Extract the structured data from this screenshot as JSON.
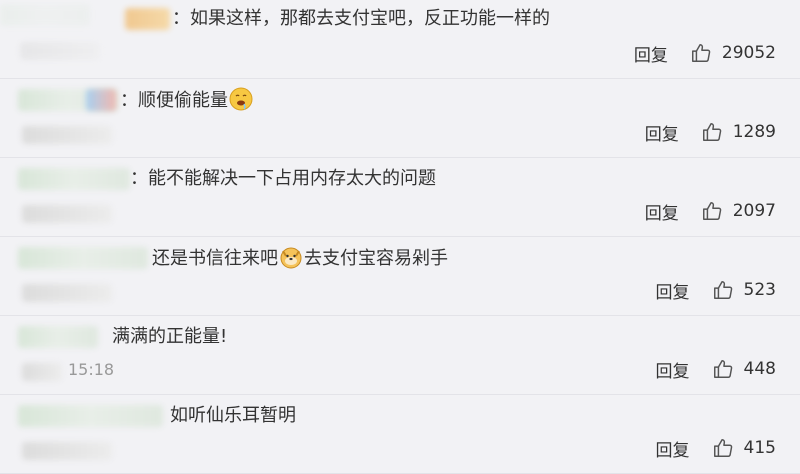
{
  "comments": [
    {
      "text": "：如果这样，那都去支付宝吧，反正功能一样的",
      "time": "",
      "reply_label": "回复",
      "likes": "29052",
      "emoji": null
    },
    {
      "text_before": "：顺便偷能量",
      "text_after": "",
      "time": "",
      "reply_label": "回复",
      "likes": "1289",
      "emoji": "drooling-face-emoji"
    },
    {
      "text": "：能不能解决一下占用内存太大的问题",
      "time": "",
      "reply_label": "回复",
      "likes": "2097",
      "emoji": null
    },
    {
      "text_before": "还是书信往来吧",
      "text_after": "去支付宝容易剁手",
      "time": "",
      "reply_label": "回复",
      "likes": "523",
      "emoji": "doge-emoji"
    },
    {
      "text": "满满的正能量!",
      "time": "15:18",
      "reply_label": "回复",
      "likes": "448",
      "emoji": null
    },
    {
      "text": "如听仙乐耳暂明",
      "time": "",
      "reply_label": "回复",
      "likes": "415",
      "emoji": null
    }
  ],
  "colors": {
    "background": "#f2f2f5",
    "text": "#333333",
    "muted": "#999999"
  },
  "icons": {
    "like": "thumbs-up-icon"
  }
}
